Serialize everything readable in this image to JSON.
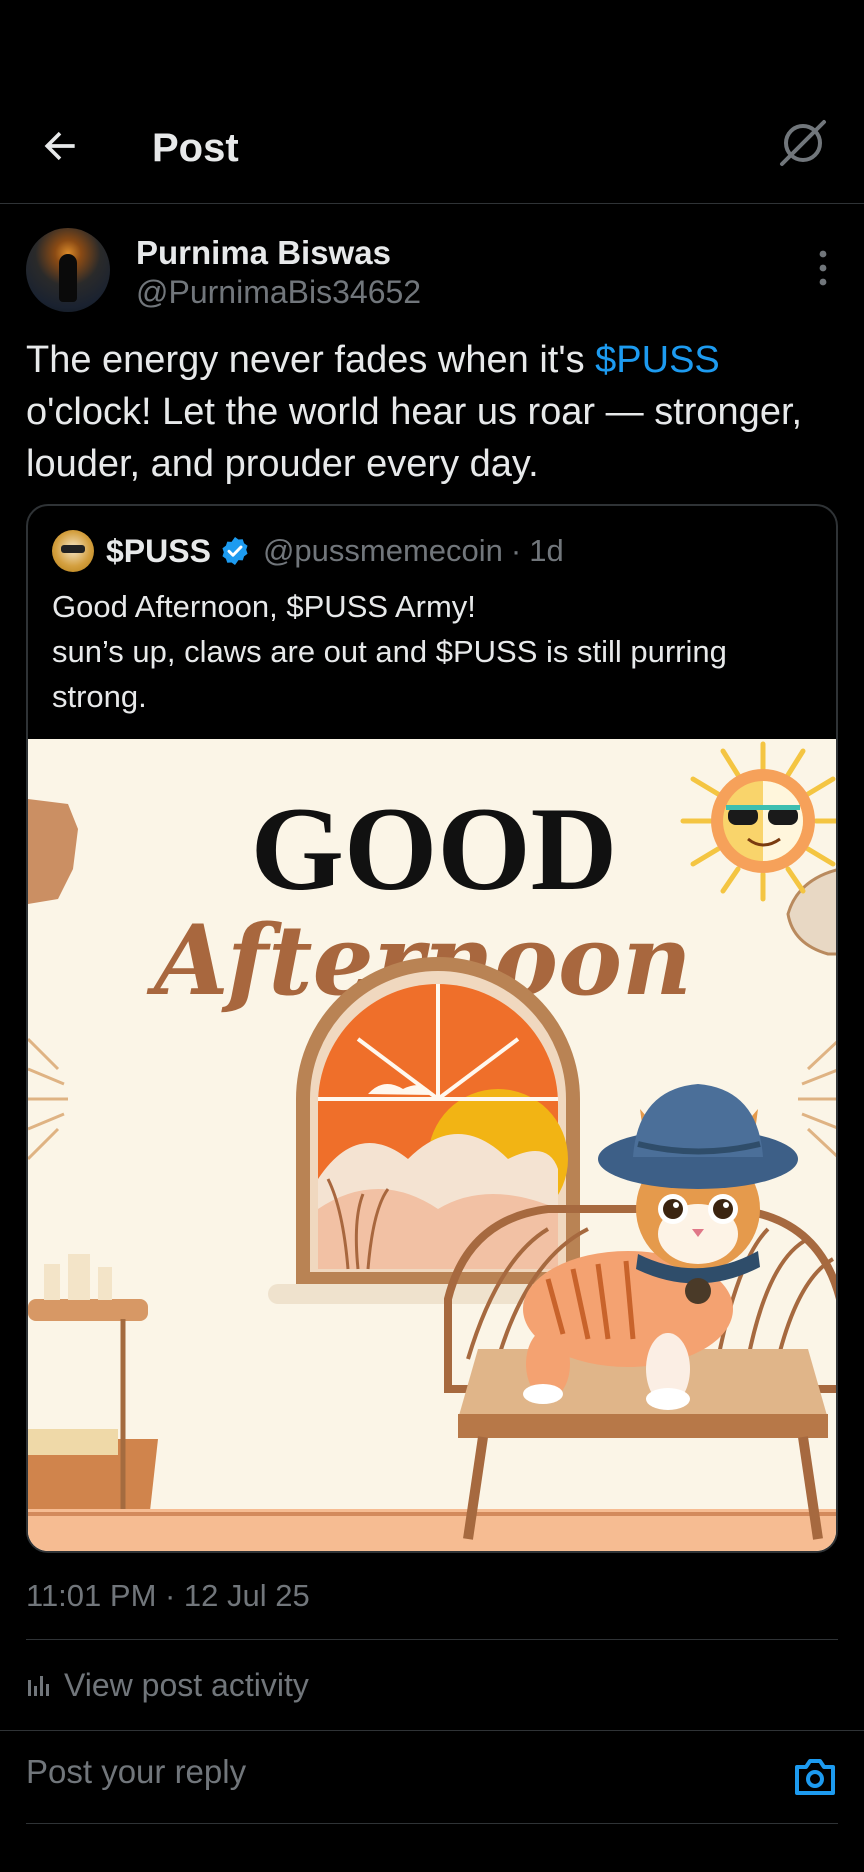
{
  "header": {
    "title": "Post",
    "back_icon": "arrow-left-icon",
    "grok_icon": "grok-icon"
  },
  "post": {
    "author_name": "Purnima Biswas",
    "author_handle": "@PurnimaBis34652",
    "text_before": "The energy never fades when it's ",
    "cashtag": "$PUSS",
    "text_after": " o'clock! Let the world hear us roar — stronger, louder, and prouder every day.",
    "timestamp": "11:01 PM · 12 Jul 25"
  },
  "quote": {
    "name": "$PUSS",
    "handle": "@pussmemecoin",
    "separator": "·",
    "age": "1d",
    "text": "Good Afternoon, $PUSS Army!\n sun’s up, claws are out and $PUSS is still purring strong.",
    "image_text_top": "GOOD",
    "image_text_script": "Afternoon"
  },
  "activity": {
    "label": "View post activity"
  },
  "reply": {
    "placeholder": "Post your reply"
  },
  "colors": {
    "background": "#000000",
    "accent": "#1d9bf0",
    "muted": "#71767b",
    "text": "#e7e9ea",
    "border": "#2f3336"
  }
}
